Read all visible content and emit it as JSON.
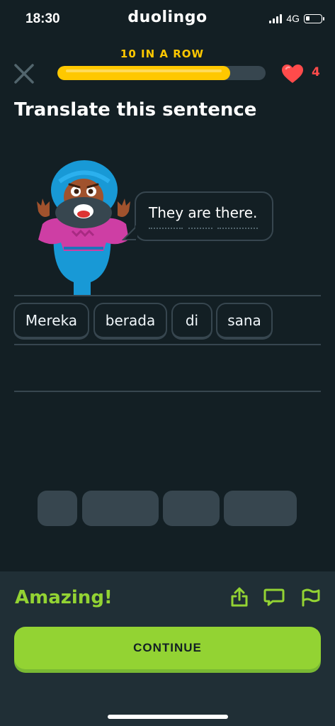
{
  "status_bar": {
    "time": "18:30",
    "app_name": "duolingo",
    "network": "4G"
  },
  "header": {
    "streak_label": "10 IN A ROW",
    "progress_fraction": 0.83,
    "hearts": "4"
  },
  "lesson": {
    "prompt": "Translate this sentence",
    "sentence": "They are there."
  },
  "answer_chips": [
    "Mereka",
    "berada",
    "di",
    "sana"
  ],
  "footer": {
    "feedback": "Amazing!",
    "continue_label": "CONTINUE"
  },
  "colors": {
    "background": "#131f24",
    "accent_yellow": "#ffc800",
    "success_green": "#93d333",
    "heart_red": "#ff4b4b",
    "footer_bg": "#202f36"
  },
  "icons": [
    "close-icon",
    "heart-icon",
    "share-icon",
    "comment-icon",
    "flag-icon"
  ]
}
